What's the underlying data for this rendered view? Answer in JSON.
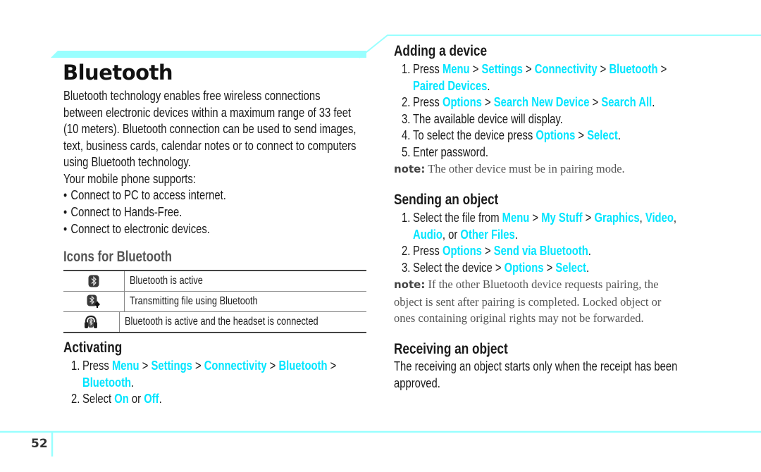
{
  "colors": {
    "accent_band": "#99ffff",
    "link": "#00e5ff",
    "text": "#1a1a1a",
    "subhead_gray": "#555555"
  },
  "page": {
    "title": "Bluetooth",
    "page_number": "52"
  },
  "intro": {
    "lines": [
      "Bluetooth technology enables free wireless connections",
      "between electronic devices within a maximum range of 33 feet",
      "(10 meters). Bluetooth connection can be used to send images,",
      "text, business cards, calendar notes or to connect to computers",
      "using Bluetooth technology."
    ],
    "supports_label": "Your mobile phone supports:",
    "bullets": [
      "Connect to PC to access internet.",
      "Connect to Hands-Free.",
      "Connect to electronic devices."
    ]
  },
  "icons_section": {
    "heading": "Icons for Bluetooth",
    "rows": [
      {
        "icon": "bluetooth-active-icon",
        "description": "Bluetooth is active"
      },
      {
        "icon": "bluetooth-transmitting-icon",
        "description": "Transmitting file using Bluetooth"
      },
      {
        "icon": "bluetooth-headset-icon",
        "description": "Bluetooth is active and the headset is connected"
      }
    ]
  },
  "activating": {
    "heading": "Activating",
    "step1": {
      "num": "1.",
      "prefix": "Press ",
      "path": [
        "Menu",
        "Settings",
        "Connectivity",
        "Bluetooth"
      ],
      "last": "Bluetooth"
    },
    "step2": {
      "num": "2.",
      "prefix": "Select ",
      "opt1": "On",
      "mid": " or ",
      "opt2": "Off"
    },
    "sep": " > ",
    "period": "."
  },
  "adding": {
    "heading": "Adding a device",
    "step1": {
      "num": "1.",
      "prefix": "Press ",
      "path": [
        "Menu",
        "Settings",
        "Connectivity",
        "Bluetooth"
      ],
      "last": "Paired Devices"
    },
    "step2": {
      "num": "2.",
      "prefix": "Press ",
      "path": [
        "Options",
        "Search New Device",
        "Search All"
      ]
    },
    "step3": {
      "num": "3.",
      "text": "The available device will display."
    },
    "step4": {
      "num": "4.",
      "prefix": "To select the device press ",
      "path": [
        "Options",
        "Select"
      ]
    },
    "step5": {
      "num": "5.",
      "text": "Enter password."
    },
    "note_label": "note:",
    "note_text": " The other device must be in pairing mode."
  },
  "sending": {
    "heading": "Sending an object",
    "step1": {
      "num": "1.",
      "prefix": "Select the file from ",
      "menu": "Menu",
      "mystuff": "My Stuff",
      "graphics": "Graphics",
      "video": "Video",
      "audio": "Audio",
      "or": ", or ",
      "other": "Other Files"
    },
    "step2": {
      "num": "2.",
      "prefix": "Press ",
      "path": [
        "Options",
        "Send via Bluetooth"
      ]
    },
    "step3": {
      "num": "3.",
      "prefix": "Select the device > ",
      "path": [
        "Options",
        "Select"
      ]
    },
    "note_label": "note:",
    "note_lines": [
      " If the other Bluetooth device requests pairing, the",
      "object is sent after pairing is completed. Locked object or",
      "ones containing original rights may not be forwarded."
    ]
  },
  "receiving": {
    "heading": "Receiving an object",
    "lines": [
      "The receiving an object starts only when the receipt has been",
      "approved."
    ]
  }
}
